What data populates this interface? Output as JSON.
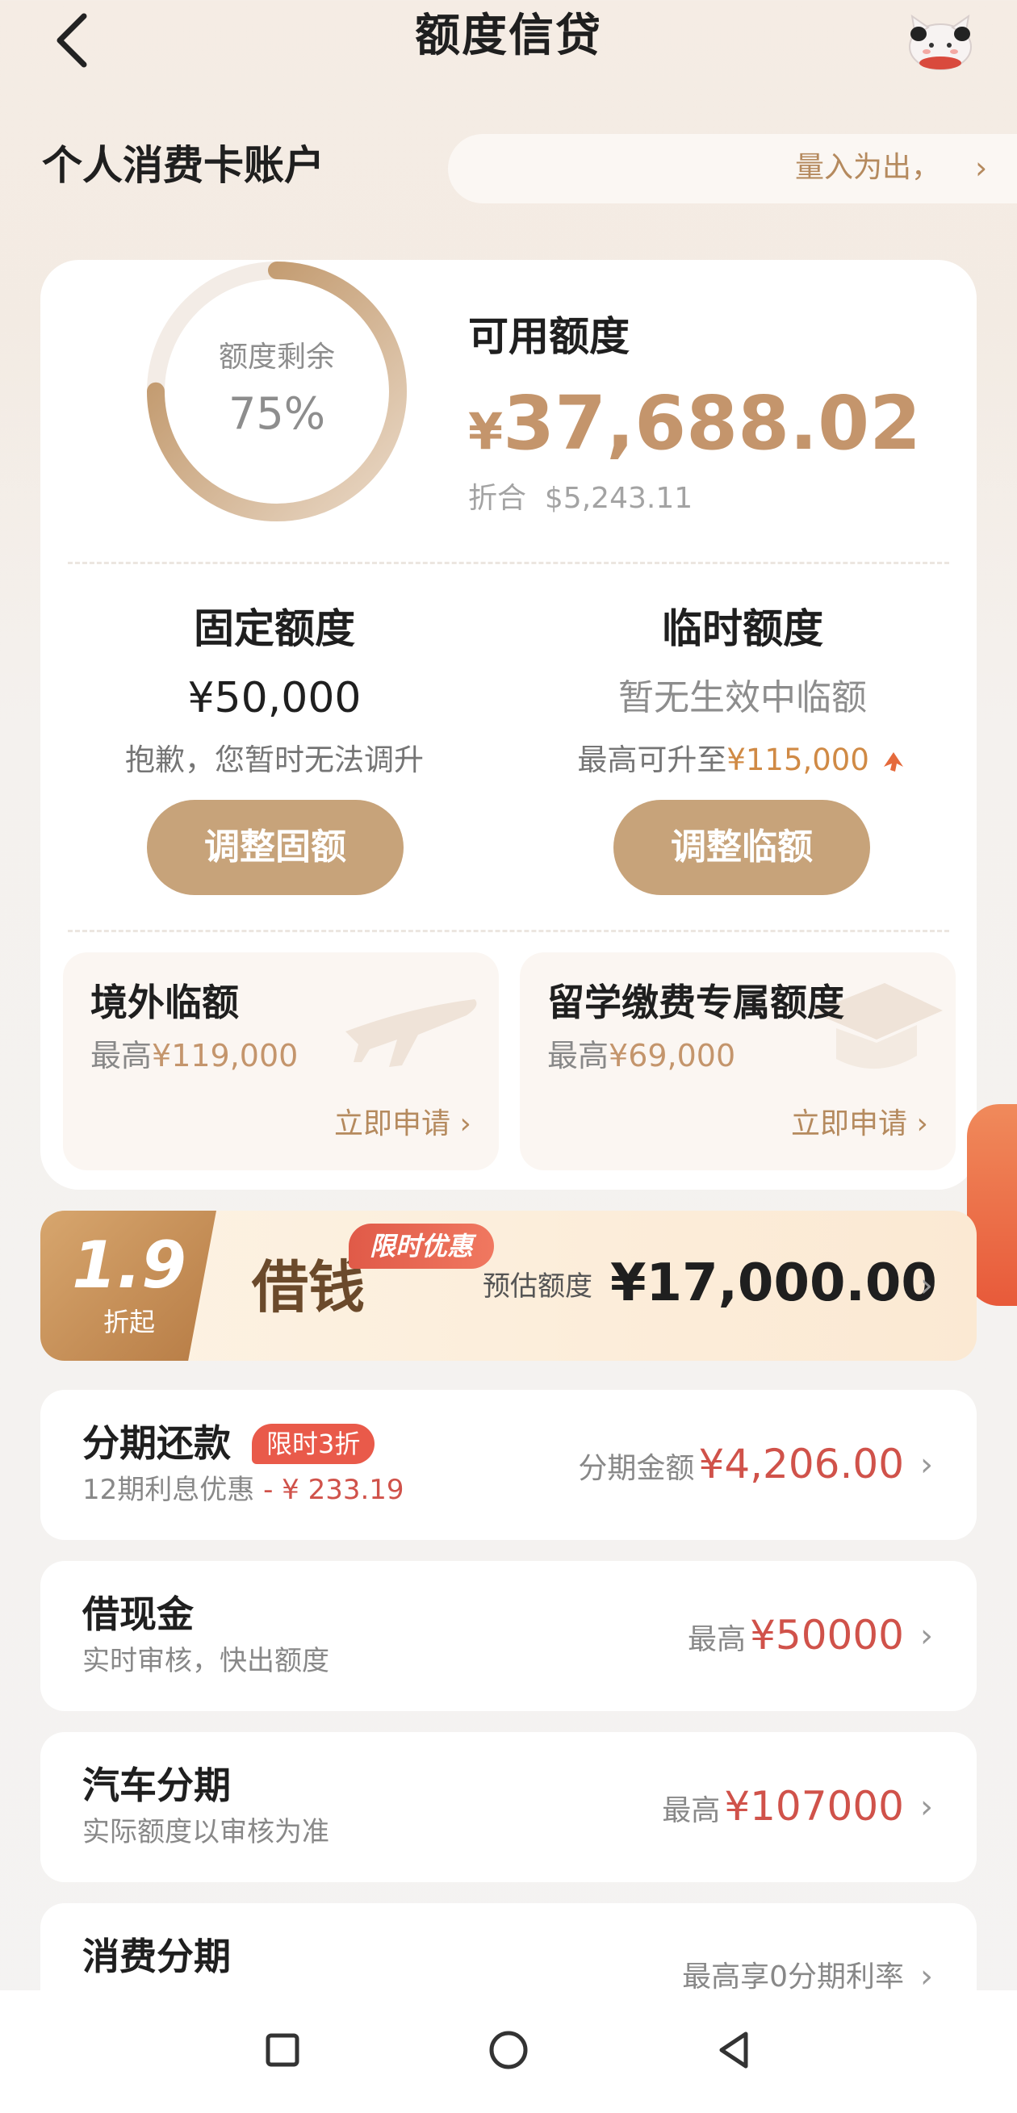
{
  "header": {
    "title": "额度信贷"
  },
  "account": {
    "section_title": "个人消费卡账户",
    "slogan": "量入为出，",
    "slogan_chevron": "›"
  },
  "credit": {
    "ring_label": "额度剩余",
    "ring_value": "75%",
    "ring_fraction": 0.75,
    "available_label": "可用额度",
    "available_currency": "¥",
    "available_amount": "37,688.02",
    "usd_prefix": "折合",
    "usd_amount": "$5,243.11"
  },
  "fixed_limit": {
    "title": "固定额度",
    "value": "¥50,000",
    "note": "抱歉，您暂时无法调升",
    "button": "调整固额"
  },
  "temp_limit": {
    "title": "临时额度",
    "value": "暂无生效中临额",
    "note_prefix": "最高可升至",
    "note_amount": "¥115,000",
    "button": "调整临额"
  },
  "overseas": {
    "title": "境外临额",
    "sub_prefix": "最高",
    "sub_amount": "¥119,000",
    "link": "立即申请 ›"
  },
  "study_abroad": {
    "title": "留学缴费专属额度",
    "sub_prefix": "最高",
    "sub_amount": "¥69,000",
    "link": "立即申请 ›"
  },
  "promo": {
    "discount": "1.9",
    "discount_sub": "折起",
    "word": "借钱",
    "tag": "限时优惠",
    "est_label": "预估额度",
    "est_amount": "¥17,000.00",
    "chevron": "›"
  },
  "rows": [
    {
      "title": "分期还款",
      "tag": "限时3折",
      "sub_prefix": "12期利息优惠",
      "sub_amount": " - ¥ 233.19",
      "right_label": "分期金额",
      "right_amount": "¥4,206.00",
      "chevron": "›"
    },
    {
      "title": "借现金",
      "sub": "实时审核，快出额度",
      "right_label": "最高",
      "right_amount": "¥50000",
      "chevron": "›"
    },
    {
      "title": "汽车分期",
      "sub": "实际额度以审核为准",
      "right_label": "最高",
      "right_amount": "¥107000",
      "chevron": "›"
    },
    {
      "title": "消费分期",
      "right_label": "最高享0分期利率",
      "chevron": "›"
    }
  ],
  "icons": {
    "back": "back-arrow-icon",
    "mascot": "mascot-avatar-icon",
    "airplane": "airplane-icon",
    "graduation": "graduation-cap-icon",
    "trend": "up-arrow-icon",
    "nav_recent": "square-icon",
    "nav_home": "circle-icon",
    "nav_back": "triangle-back-icon"
  },
  "colors": {
    "accent_gold": "#c4956c",
    "button_gold": "#c7a37a",
    "highlight_orange": "#d08a45",
    "price_red": "#d0524a",
    "tag_red": "#e95a4a"
  }
}
